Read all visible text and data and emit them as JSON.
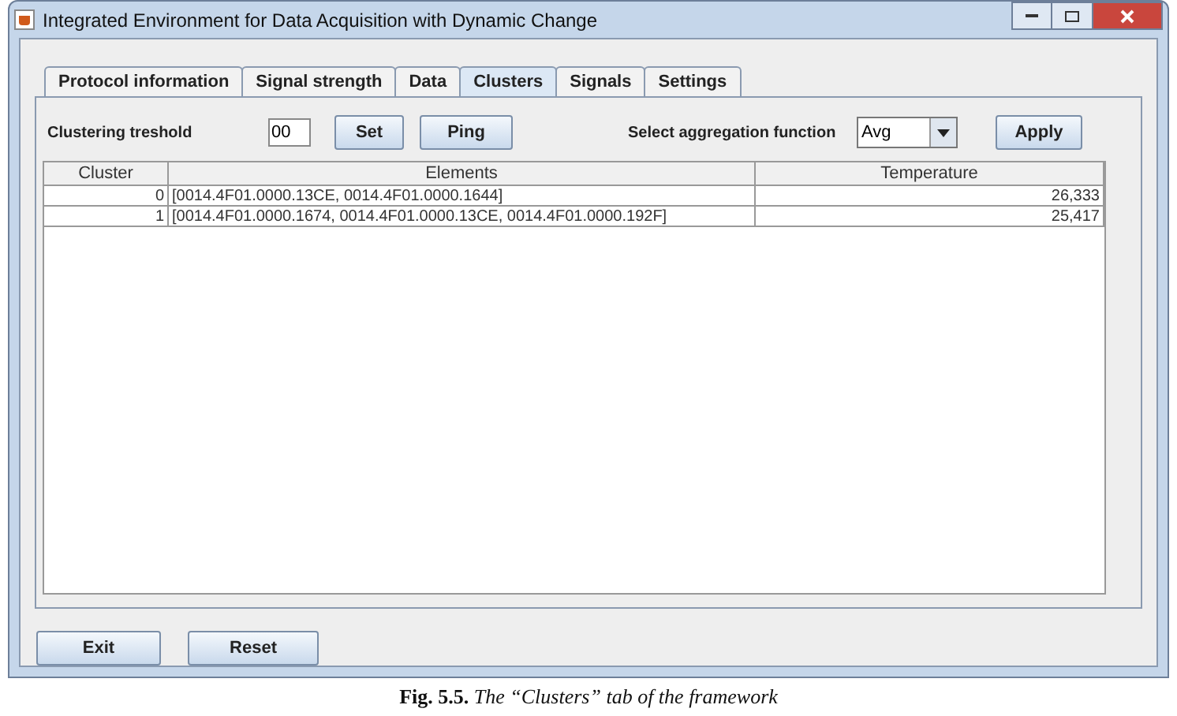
{
  "window": {
    "title": "Integrated Environment for Data Acquisition with Dynamic Change"
  },
  "tabs": [
    {
      "label": "Protocol information",
      "selected": false
    },
    {
      "label": "Signal strength",
      "selected": false
    },
    {
      "label": "Data",
      "selected": false
    },
    {
      "label": "Clusters",
      "selected": true
    },
    {
      "label": "Signals",
      "selected": false
    },
    {
      "label": "Settings",
      "selected": false
    }
  ],
  "threshold": {
    "label": "Clustering treshold",
    "value": "00"
  },
  "buttons_top": [
    "Set",
    "Ping"
  ],
  "aggregation": {
    "label": "Select aggregation function",
    "value": "Avg"
  },
  "apply_button": "Apply",
  "table": {
    "columns": [
      "Cluster",
      "Elements",
      "Temperature"
    ],
    "rows": [
      [
        "0",
        "[0014.4F01.0000.13CE, 0014.4F01.0000.1644]",
        "26,333"
      ],
      [
        "1",
        "[0014.4F01.0000.1674, 0014.4F01.0000.13CE, 0014.4F01.0000.192F]",
        "25,417"
      ]
    ]
  },
  "buttons_bottom": [
    "Exit",
    "Reset"
  ],
  "caption": "**Fig. 5.5.** *The “Clusters” tab of the framework*"
}
